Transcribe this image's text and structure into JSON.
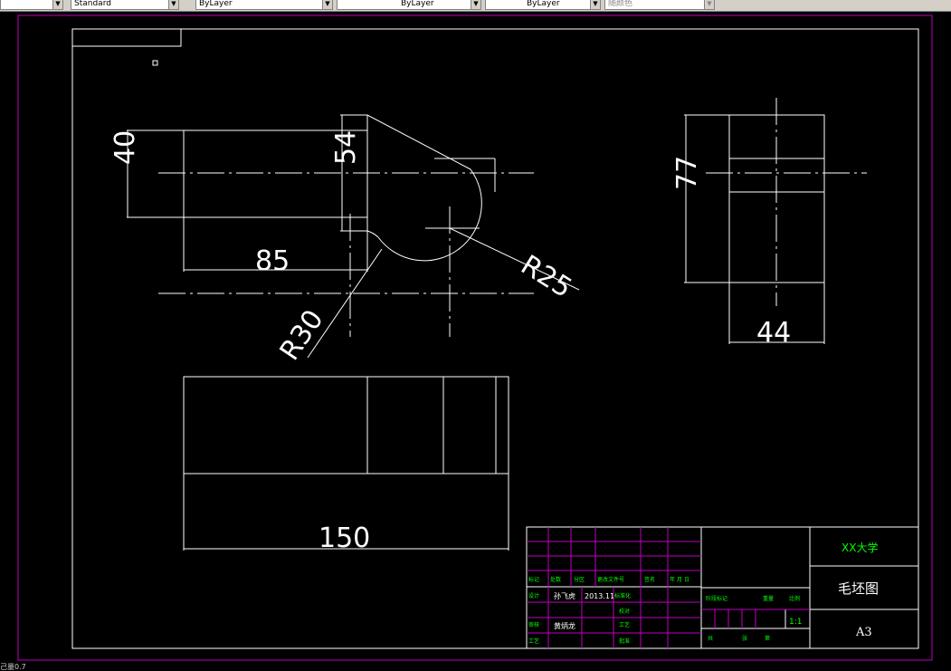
{
  "toolbar": {
    "combo_left": "",
    "text_style": "Standard",
    "layer_color": "ByLayer",
    "layer_linetype": "ByLayer",
    "layer_lineweight": "ByLayer",
    "plot_style": "随颜色"
  },
  "status": {
    "command_text": "己量0.7"
  },
  "drawing": {
    "dims": {
      "d40": "40",
      "d54": "54",
      "d85": "85",
      "r25": "R25",
      "r30": "R30",
      "d77": "77",
      "d44": "44",
      "d150": "150"
    }
  },
  "title_block": {
    "school": "XX大学",
    "drawing_name": "毛坯图",
    "sheet_size": "A3",
    "scale": "1:1",
    "designer": "孙飞虎",
    "date": "2013.11",
    "reviewer": "黄炳龙",
    "labels": {
      "mark": "标记",
      "count": "处数",
      "zone": "分区",
      "doc_no": "更改文件号",
      "sign": "签名",
      "ymd": "年 月 日",
      "design": "设计",
      "standardize": "标准化",
      "proofread": "校对",
      "audit": "审核",
      "process": "工艺",
      "approve": "批准",
      "stage_mark": "阶段标记",
      "weight": "重量",
      "scale_label": "比例",
      "total": "共",
      "sheets": "张",
      "page": "第"
    }
  }
}
